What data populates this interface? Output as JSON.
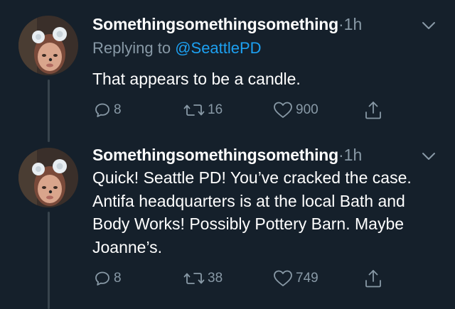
{
  "tweets": [
    {
      "name": "Somethingsomethingsomething",
      "separator": "·",
      "time": "1h",
      "replying_prefix": "Replying to ",
      "replying_handle": "@SeattlePD",
      "text": "That appears to be a candle.",
      "replies": "8",
      "retweets": "16",
      "likes": "900"
    },
    {
      "name": "Somethingsomethingsomething",
      "separator": "·",
      "time": "1h",
      "text": "Quick! Seattle PD! You’ve cracked the case. Antifa headquarters is at the local Bath and Body Works! Possibly Pottery Barn. Maybe Joanne’s.",
      "replies": "8",
      "retweets": "38",
      "likes": "749"
    }
  ],
  "icons": {
    "reply": "reply-icon",
    "retweet": "retweet-icon",
    "like": "heart-icon",
    "share": "share-icon",
    "menu": "chevron-down-icon"
  },
  "colors": {
    "background": "#15202b",
    "secondary_text": "#8899a6",
    "link": "#1da1f2",
    "thread_line": "#38444d"
  }
}
